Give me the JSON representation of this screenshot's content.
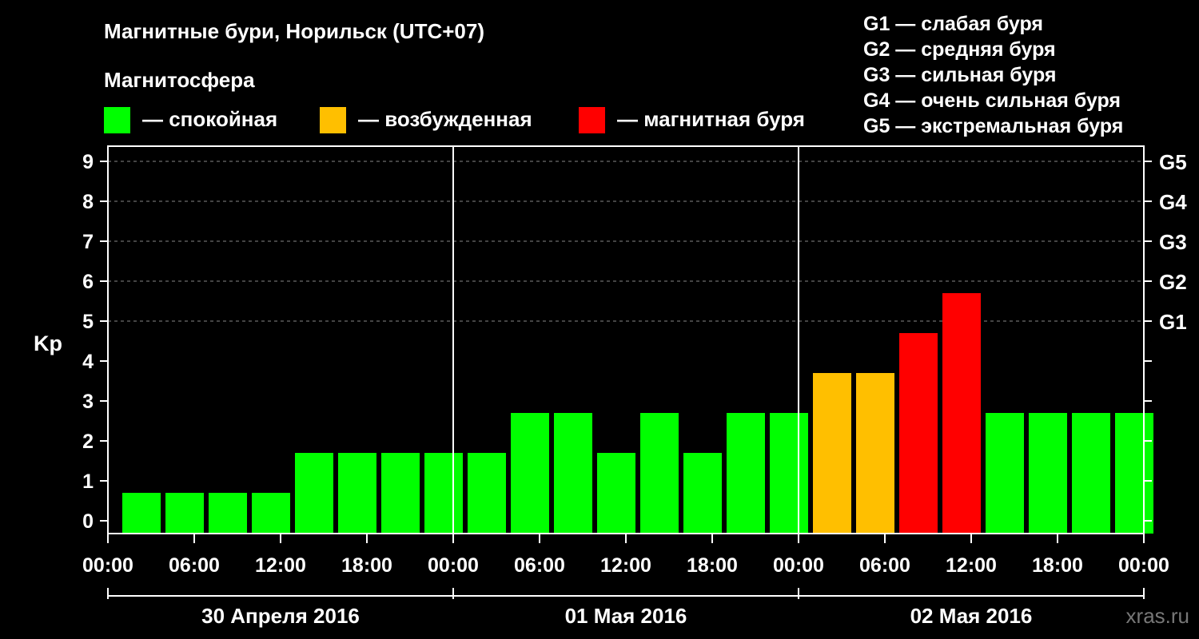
{
  "header": {
    "title": "Магнитные бури, Норильск (UTC+07)",
    "subtitle": "Магнитосфера"
  },
  "legend": {
    "items": [
      {
        "label": "— спокойная",
        "color": "#00ff00"
      },
      {
        "label": "— возбужденная",
        "color": "#ffbf00"
      },
      {
        "label": "— магнитная буря",
        "color": "#ff0000"
      }
    ]
  },
  "g_levels": [
    "G1 — слабая буря",
    "G2 — средняя буря",
    "G3 — сильная буря",
    "G4 — очень сильная буря",
    "G5 — экстремальная буря"
  ],
  "watermark": "xras.ru",
  "chart_data": {
    "type": "bar",
    "ylabel": "Kp",
    "ylim": [
      0,
      9
    ],
    "y_ticks": [
      0,
      1,
      2,
      3,
      4,
      5,
      6,
      7,
      8,
      9
    ],
    "right_axis_labels": [
      {
        "kp": 5,
        "label": "G1"
      },
      {
        "kp": 6,
        "label": "G2"
      },
      {
        "kp": 7,
        "label": "G3"
      },
      {
        "kp": 8,
        "label": "G4"
      },
      {
        "kp": 9,
        "label": "G5"
      }
    ],
    "x_tick_labels": [
      "00:00",
      "06:00",
      "12:00",
      "18:00",
      "00:00",
      "06:00",
      "12:00",
      "18:00",
      "00:00",
      "06:00",
      "12:00",
      "18:00",
      "00:00"
    ],
    "days": [
      "30 Апреля 2016",
      "01 Мая 2016",
      "02 Мая 2016"
    ],
    "interval_hours": 3,
    "values": [
      1,
      1,
      1,
      1,
      2,
      2,
      2,
      2,
      2,
      3,
      3,
      2,
      3,
      2,
      3,
      3,
      4,
      4,
      5,
      6,
      3,
      3,
      3,
      3
    ],
    "colors": {
      "quiet": "#00ff00",
      "active": "#ffbf00",
      "storm": "#ff0000"
    },
    "grid": true,
    "legend_position": "top"
  }
}
